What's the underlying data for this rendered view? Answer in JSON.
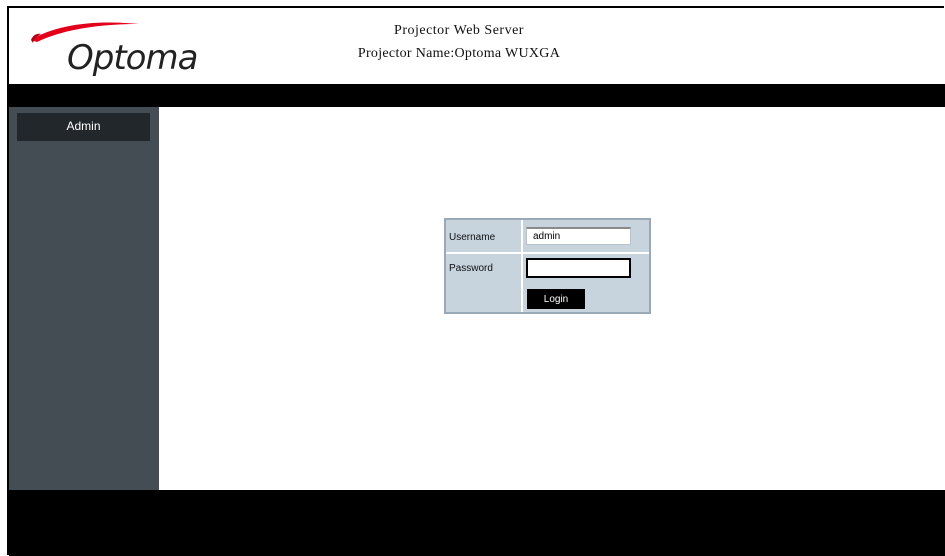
{
  "header": {
    "logo_text": "Optoma",
    "title": "Projector Web Server",
    "projector_name": "Projector Name:Optoma WUXGA"
  },
  "sidebar": {
    "items": [
      {
        "label": "Admin"
      }
    ]
  },
  "login": {
    "username_label": "Username",
    "username_value": "admin",
    "password_label": "Password",
    "password_value": "",
    "login_button": "Login"
  },
  "colors": {
    "sidebar": "#454d54",
    "sidebar_item": "#22272c",
    "login_panel": "#c7d3dd",
    "bars": "#000000"
  }
}
